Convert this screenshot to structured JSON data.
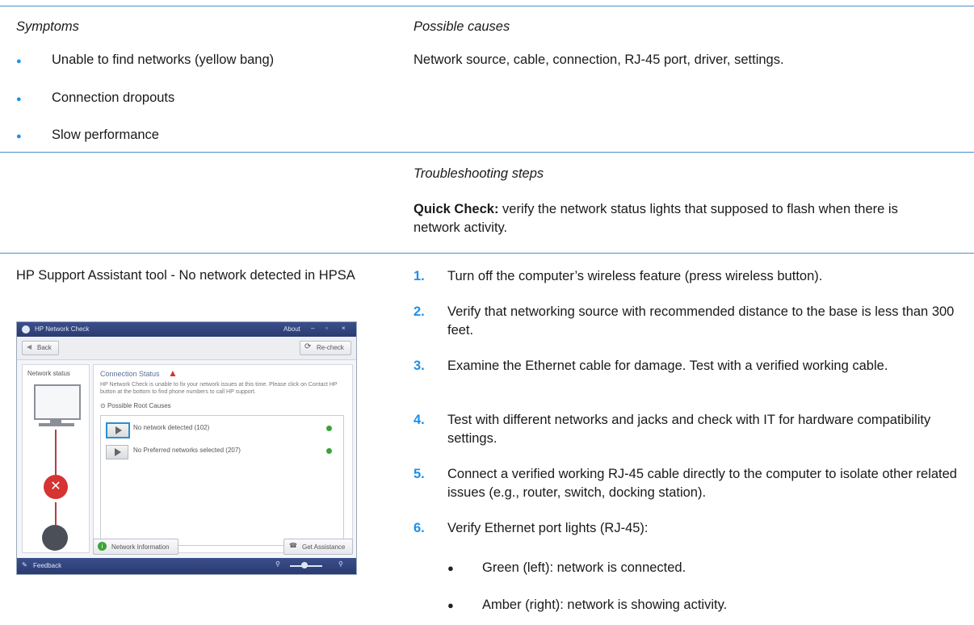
{
  "row1": {
    "left_heading": "Symptoms",
    "right_heading": "Possible causes",
    "symptoms": [
      "Unable to find networks (yellow bang)",
      "Connection dropouts",
      "Slow performance"
    ],
    "causes": "Network source, cable, connection, RJ-45 port, driver, settings."
  },
  "row2": {
    "heading": "Troubleshooting steps",
    "quick_label": "Quick Check:",
    "quick_text": " verify the network status lights that supposed to flash when there is network activity."
  },
  "row3": {
    "left_title": "HP Support Assistant tool - No network detected in HPSA",
    "steps": [
      {
        "num": "1.",
        "text": "Turn off the computer’s wireless feature (press wireless button)."
      },
      {
        "num": "2.",
        "text": "Verify that networking source with recommended distance to the base is less than 300 feet."
      },
      {
        "num": "3.",
        "text": "Examine the Ethernet cable for damage. Test with a verified working cable."
      },
      {
        "num": "4.",
        "text": "Test with different networks and jacks and check with IT for hardware compatibility settings."
      },
      {
        "num": "5.",
        "text": "Connect a verified working RJ-45 cable directly to the computer to isolate other related issues (e.g., router, switch, docking station)."
      },
      {
        "num": "6.",
        "text": "Verify Ethernet port lights (RJ-45):"
      }
    ],
    "sub_bullets": [
      "Green (left): network is connected.",
      "Amber (right): network is showing activity."
    ]
  },
  "screenshot": {
    "window_title": "HP Network Check",
    "about": "About",
    "back": "Back",
    "recheck": "Re-check",
    "network_status": "Network status",
    "connection_status": "Connection Status",
    "description": "HP Network Check is unable to fix your network issues at this time. Please click on Contact HP button at the bottom to find phone numbers to call HP support.",
    "possible_root_causes": "Possible Root Causes",
    "cause1": "No network detected (102)",
    "cause2": "No Preferred networks selected (207)",
    "network_information": "Network Information",
    "get_assistance": "Get Assistance",
    "feedback": "Feedback"
  }
}
